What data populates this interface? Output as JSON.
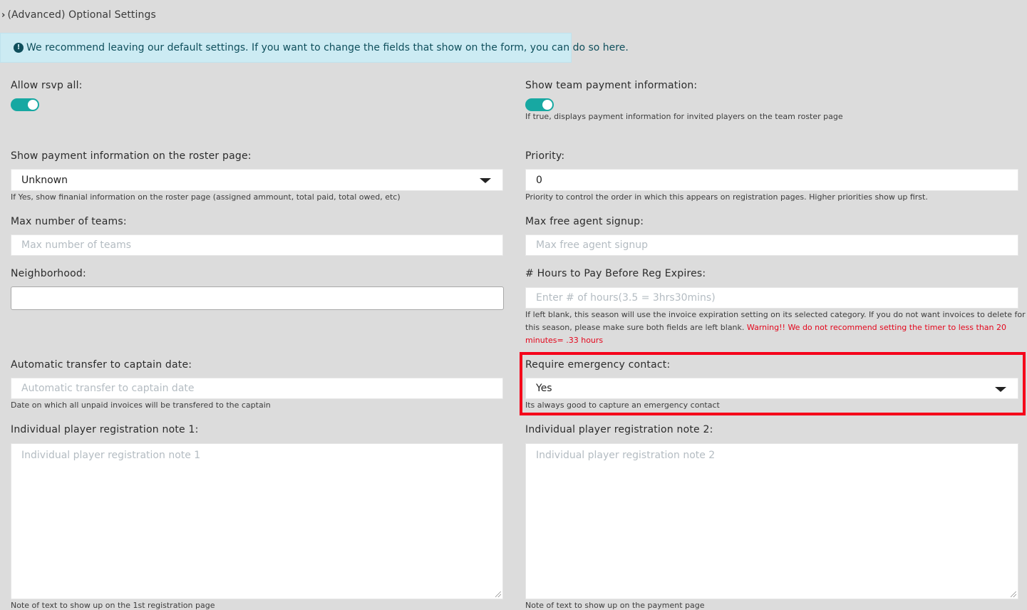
{
  "section": {
    "toggle_label": "(Advanced) Optional Settings"
  },
  "alert": {
    "text": "We recommend leaving our default settings. If you want to change the fields that show on the form, you can do so here."
  },
  "fields": {
    "allow_rsvp_all": {
      "label": "Allow rsvp all:",
      "value": true
    },
    "show_team_payment": {
      "label": "Show team payment information:",
      "value": true,
      "help": "If true, displays payment information for invited players on the team roster page"
    },
    "show_payment_roster": {
      "label": "Show payment information on the roster page:",
      "selected": "Unknown",
      "help": "If Yes, show finanial information on the roster page (assigned ammount, total paid, total owed, etc)"
    },
    "priority": {
      "label": "Priority:",
      "value": "0",
      "help": "Priority to control the order in which this appears on registration pages. Higher priorities show up first."
    },
    "max_teams": {
      "label": "Max number of teams:",
      "placeholder": "Max number of teams"
    },
    "max_free_agent": {
      "label": "Max free agent signup:",
      "placeholder": "Max free agent signup"
    },
    "neighborhood": {
      "label": "Neighborhood:",
      "value": ""
    },
    "hours_to_pay": {
      "label": "# Hours to Pay Before Reg Expires:",
      "placeholder": "Enter # of hours(3.5 = 3hrs30mins)",
      "help_line1": "If left blank, this season will use the invoice expiration setting on its selected category. If you do not want invoices to delete for",
      "help_line2": "this season, please make sure both fields are left blank.",
      "warning_line2": "Warning!! We do not recommend setting the timer to less than 20",
      "warning_line3": "minutes= .33 hours"
    },
    "auto_transfer_captain": {
      "label": "Automatic transfer to captain date:",
      "placeholder": "Automatic transfer to captain date",
      "help": "Date on which all unpaid invoices will be transfered to the captain"
    },
    "require_emergency_contact": {
      "label": "Require emergency contact:",
      "selected": "Yes",
      "help": "Its always good to capture an emergency contact"
    },
    "reg_note_1": {
      "label": "Individual player registration note 1:",
      "placeholder": "Individual player registration note 1",
      "help": "Note of text to show up on the 1st registration page"
    },
    "reg_note_2": {
      "label": "Individual player registration note 2:",
      "placeholder": "Individual player registration note 2",
      "help": "Note of text to show up on the payment page"
    }
  },
  "colors": {
    "background": "#dcdcdc",
    "alert_bg": "#ccebf3",
    "alert_text": "#0f4f5c",
    "toggle_on": "#17a8a2",
    "warning": "#e4061c",
    "highlight": "#f5001a"
  },
  "icons": {
    "section_toggle": "chevron-right-icon",
    "alert": "info-circle-icon",
    "select_caret": "caret-down-icon"
  }
}
